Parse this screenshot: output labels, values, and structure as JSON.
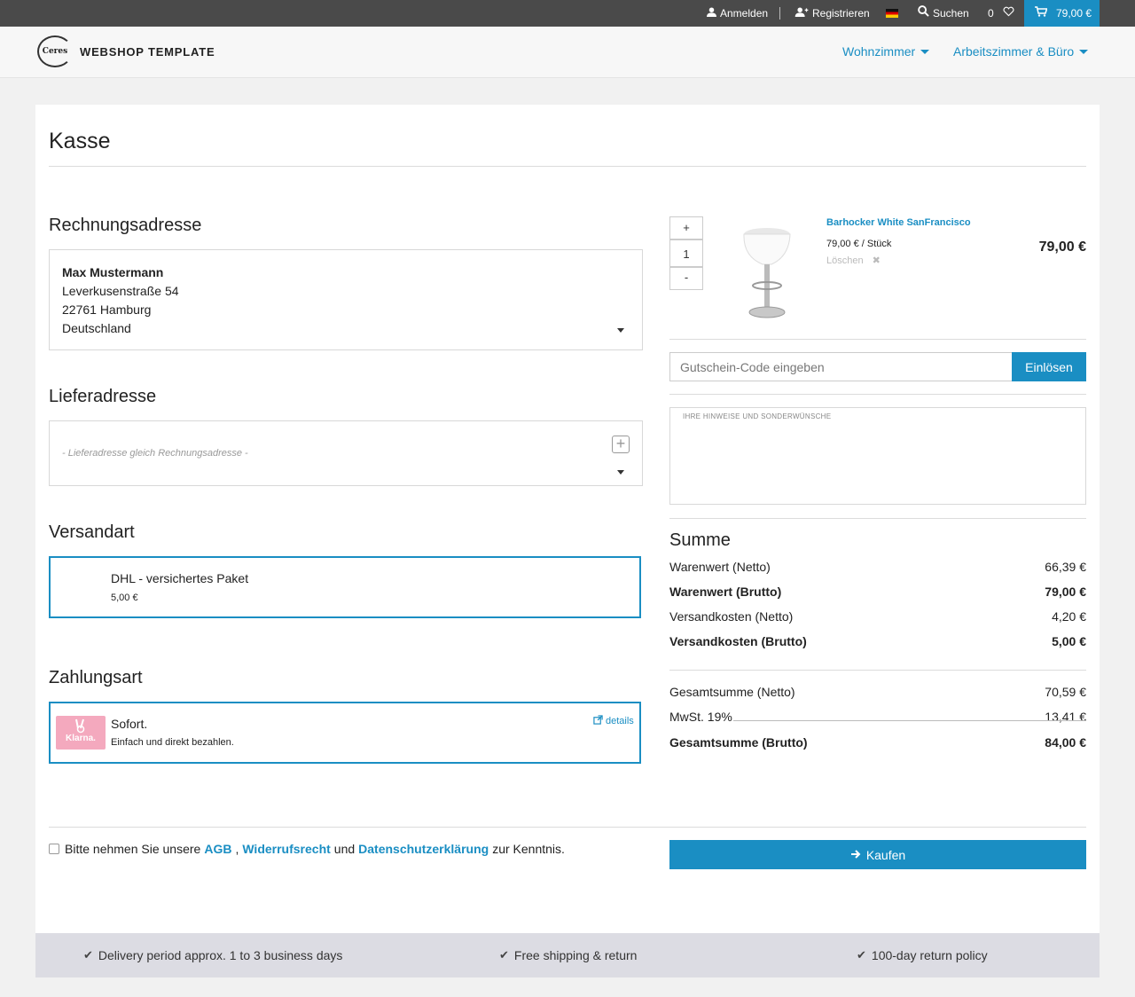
{
  "topbar": {
    "login": "Anmelden",
    "register": "Registrieren",
    "search": "Suchen",
    "wishlist_count": "0",
    "cart_total": "79,00 €"
  },
  "header": {
    "logo_mark": "Ceres",
    "logo_text": "WEBSHOP TEMPLATE",
    "nav": [
      "Wohnzimmer",
      "Arbeitszimmer & Büro"
    ]
  },
  "page": {
    "title": "Kasse"
  },
  "billing": {
    "title": "Rechnungsadresse",
    "name": "Max Mustermann",
    "street": "Leverkusenstraße 54",
    "city": "22761 Hamburg",
    "country": "Deutschland"
  },
  "shipping_address": {
    "title": "Lieferadresse",
    "placeholder": "- Lieferadresse gleich Rechnungsadresse -"
  },
  "shipping_method": {
    "title": "Versandart",
    "name": "DHL - versichertes Paket",
    "price": "5,00 €"
  },
  "payment": {
    "title": "Zahlungsart",
    "logo_text": "Klarna.",
    "name": "Sofort.",
    "description": "Einfach und direkt bezahlen.",
    "details": "details"
  },
  "basket": {
    "item_name": "Barhocker White SanFrancisco",
    "unit_price": "79,00 € / Stück",
    "delete": "Löschen",
    "total": "79,00 €",
    "qty_plus": "+",
    "qty_value": "1",
    "qty_minus": "-"
  },
  "coupon": {
    "placeholder": "Gutschein-Code eingeben",
    "button": "Einlösen"
  },
  "notes": {
    "label": "IHRE HINWEISE UND SONDERWÜNSCHE"
  },
  "summary": {
    "title": "Summe",
    "rows": [
      {
        "label": "Warenwert (Netto)",
        "value": "66,39 €"
      },
      {
        "label": "Warenwert (Brutto)",
        "value": "79,00 €"
      },
      {
        "label": "Versandkosten (Netto)",
        "value": "4,20 €"
      },
      {
        "label": "Versandkosten (Brutto)",
        "value": "5,00 €"
      },
      {
        "label": "Gesamtsumme (Netto)",
        "value": "70,59 €"
      },
      {
        "label": "MwSt. 19%",
        "value": "13,41 €"
      },
      {
        "label": "Gesamtsumme (Brutto)",
        "value": "84,00 €"
      }
    ]
  },
  "terms": {
    "prefix": "Bitte nehmen Sie unsere",
    "agb": "AGB",
    "comma": ",",
    "revocation": "Widerrufsrecht",
    "and": "und",
    "privacy": "Datenschutzerklärung",
    "suffix": "zur Kenntnis."
  },
  "buy_button": "Kaufen",
  "footer": [
    "Delivery period approx. 1 to 3 business days",
    "Free shipping & return",
    "100-day return policy"
  ]
}
